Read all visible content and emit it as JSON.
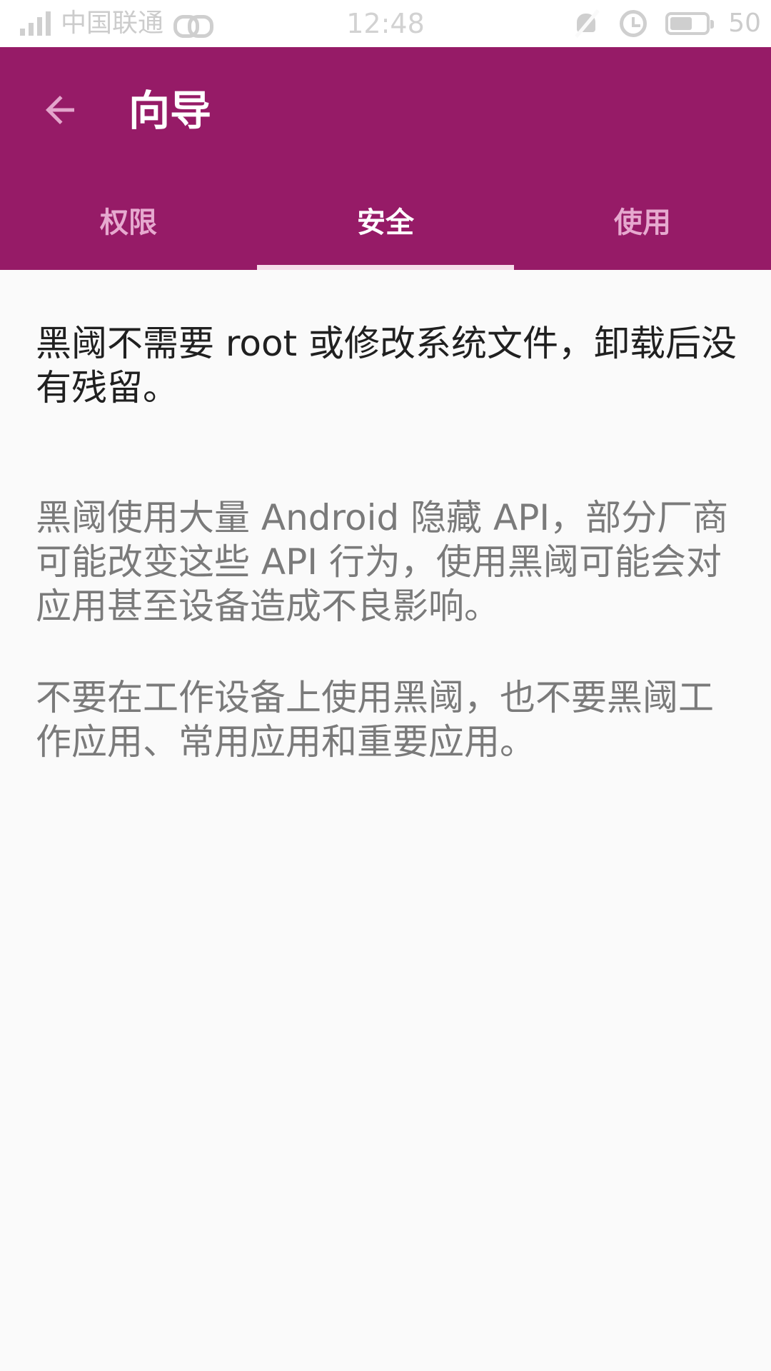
{
  "status_bar": {
    "carrier": "中国联通",
    "time": "12:48",
    "battery_level": "50",
    "icons": [
      "signal-icon",
      "link-icon",
      "mute-icon",
      "alarm-icon",
      "battery-icon"
    ]
  },
  "app_bar": {
    "title": "向导",
    "back_icon": "arrow-left-icon",
    "color": "#961b67"
  },
  "tabs": [
    {
      "label": "权限",
      "active": false
    },
    {
      "label": "安全",
      "active": true
    },
    {
      "label": "使用",
      "active": false
    }
  ],
  "content": {
    "lead": "黑阈不需要 root 或修改系统文件，卸载后没有残留。",
    "paragraph_1": "黑阈使用大量 Android 隐藏 API，部分厂商可能改变这些 API 行为，使用黑阈可能会对应用甚至设备造成不良影响。",
    "paragraph_2": "不要在工作设备上使用黑阈，也不要黑阈工作应用、常用应用和重要应用。"
  }
}
